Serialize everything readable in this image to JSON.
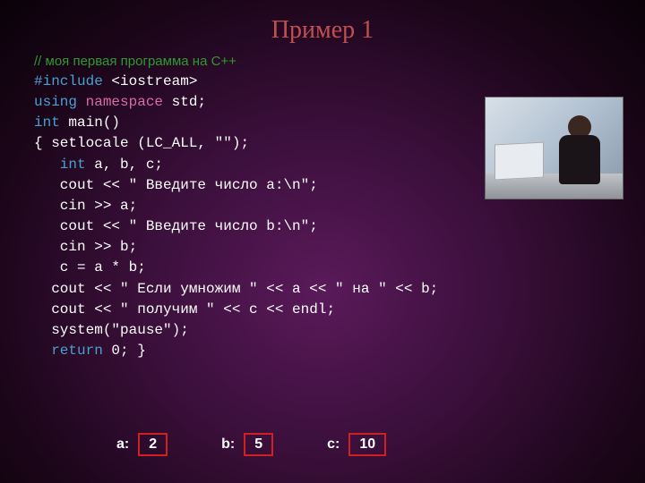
{
  "title": "Пример 1",
  "code": {
    "comment": "// моя первая программа на С++",
    "include_kw": "#include",
    "include_arg": " <iostream>",
    "using": "using",
    "namespace": " namespace",
    "std": " std;",
    "int_kw": "int",
    "main_sig": " main()",
    "brace_setlocale": "{ setlocale (LC_ALL, \"\");",
    "decl_int": "   int",
    "decl_vars": " a, b, c;",
    "cout_a": "   cout << \" Введите число a:\\n\";",
    "cin_a": "   cin >> a;",
    "cout_b": "   cout << \" Введите число b:\\n\";",
    "cin_b": "   cin >> b;",
    "calc": "   c = a * b;",
    "cout_mul": "  cout << \" Если умножим \" << a << \" на \" << b;",
    "cout_res": "  cout << \" получим \" << c << endl;",
    "pause": "  system(\"pause\");",
    "return_kw": "  return",
    "return_rest": " 0; }"
  },
  "vars": {
    "a_label": "a:",
    "a_value": "2",
    "b_label": "b:",
    "b_value": "5",
    "c_label": "c:",
    "c_value": "10"
  }
}
